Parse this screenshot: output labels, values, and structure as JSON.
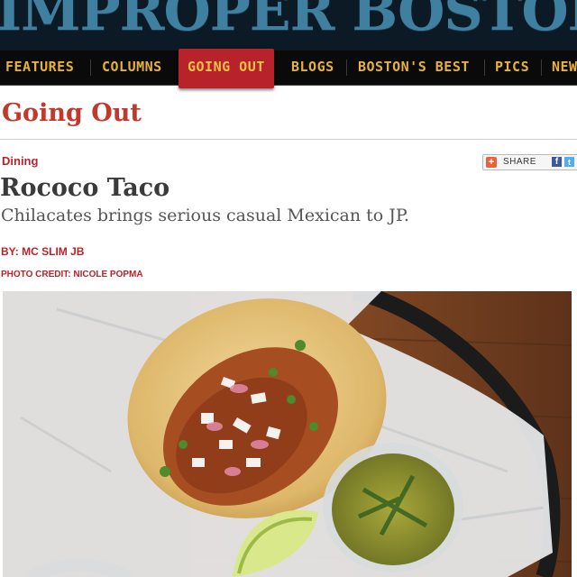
{
  "masthead": {
    "title": "IMPROPER BOSTONIAN"
  },
  "nav": {
    "items": [
      {
        "label": "FEATURES",
        "active": false
      },
      {
        "label": "COLUMNS",
        "active": false
      },
      {
        "label": "GOING OUT",
        "active": true
      },
      {
        "label": "BLOGS",
        "active": false
      },
      {
        "label": "BOSTON'S BEST",
        "active": false
      },
      {
        "label": "PICS",
        "active": false
      },
      {
        "label": "NEW",
        "active": false
      }
    ]
  },
  "section": {
    "title": "Going Out"
  },
  "article": {
    "category": "Dining",
    "title": "Rococo Taco",
    "subtitle": "Chilacates brings serious casual Mexican to JP.",
    "byline": "BY: MC SLIM JB",
    "photo_credit": "PHOTO CREDIT: NICOLE POPMA"
  },
  "share": {
    "label": "SHARE",
    "icons": [
      "plus-icon",
      "facebook-icon",
      "twitter-icon"
    ]
  },
  "colors": {
    "accent": "#b8232b",
    "nav_text": "#e8b23a",
    "masthead_bg": "#0b1a24"
  }
}
